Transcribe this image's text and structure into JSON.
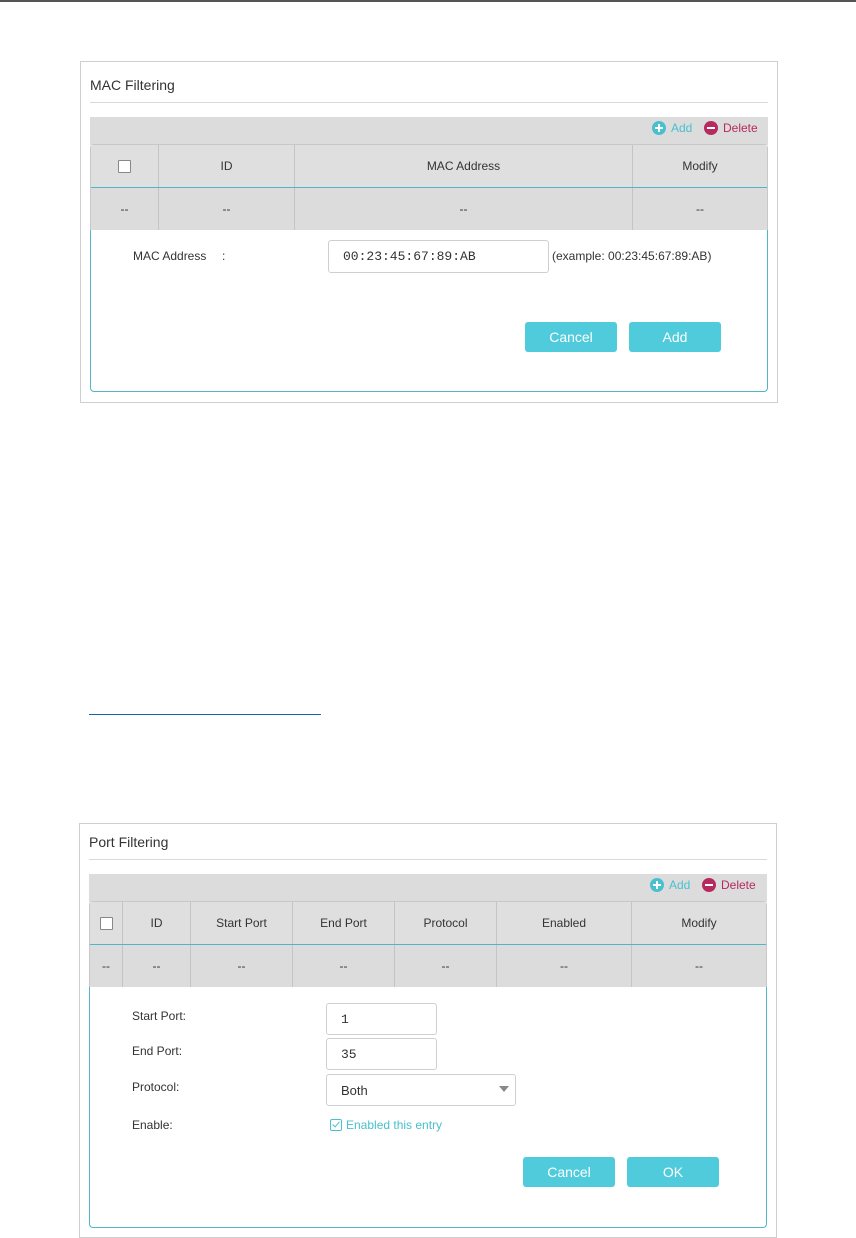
{
  "mac_filtering": {
    "title": "MAC Filtering",
    "toolbar": {
      "add_label": "Add",
      "delete_label": "Delete"
    },
    "columns": [
      "ID",
      "MAC Address",
      "Modify"
    ],
    "row": [
      "--",
      "--",
      "--",
      "--"
    ],
    "form": {
      "mac_label": "MAC Address",
      "colon": ":",
      "mac_value": "00:23:45:67:89:AB",
      "example": "(example: 00:23:45:67:89:AB)",
      "cancel_label": "Cancel",
      "add_label": "Add"
    }
  },
  "port_filtering": {
    "title": "Port Filtering",
    "toolbar": {
      "add_label": "Add",
      "delete_label": "Delete"
    },
    "columns": [
      "ID",
      "Start Port",
      "End Port",
      "Protocol",
      "Enabled",
      "Modify"
    ],
    "row": [
      "--",
      "--",
      "--",
      "--",
      "--",
      "--",
      "--"
    ],
    "form": {
      "start_port_label": "Start Port:",
      "start_port_value": "1",
      "end_port_label": "End Port:",
      "end_port_value": "35",
      "protocol_label": "Protocol:",
      "protocol_value": "Both",
      "enable_label": "Enable:",
      "enable_checkbox_label": "Enabled this entry",
      "enable_checked": true,
      "cancel_label": "Cancel",
      "ok_label": "OK"
    }
  },
  "colors": {
    "accent": "#4fcbdb",
    "add": "#49c0cf",
    "delete": "#b62a5f",
    "link_rule": "#1d5fa8"
  }
}
